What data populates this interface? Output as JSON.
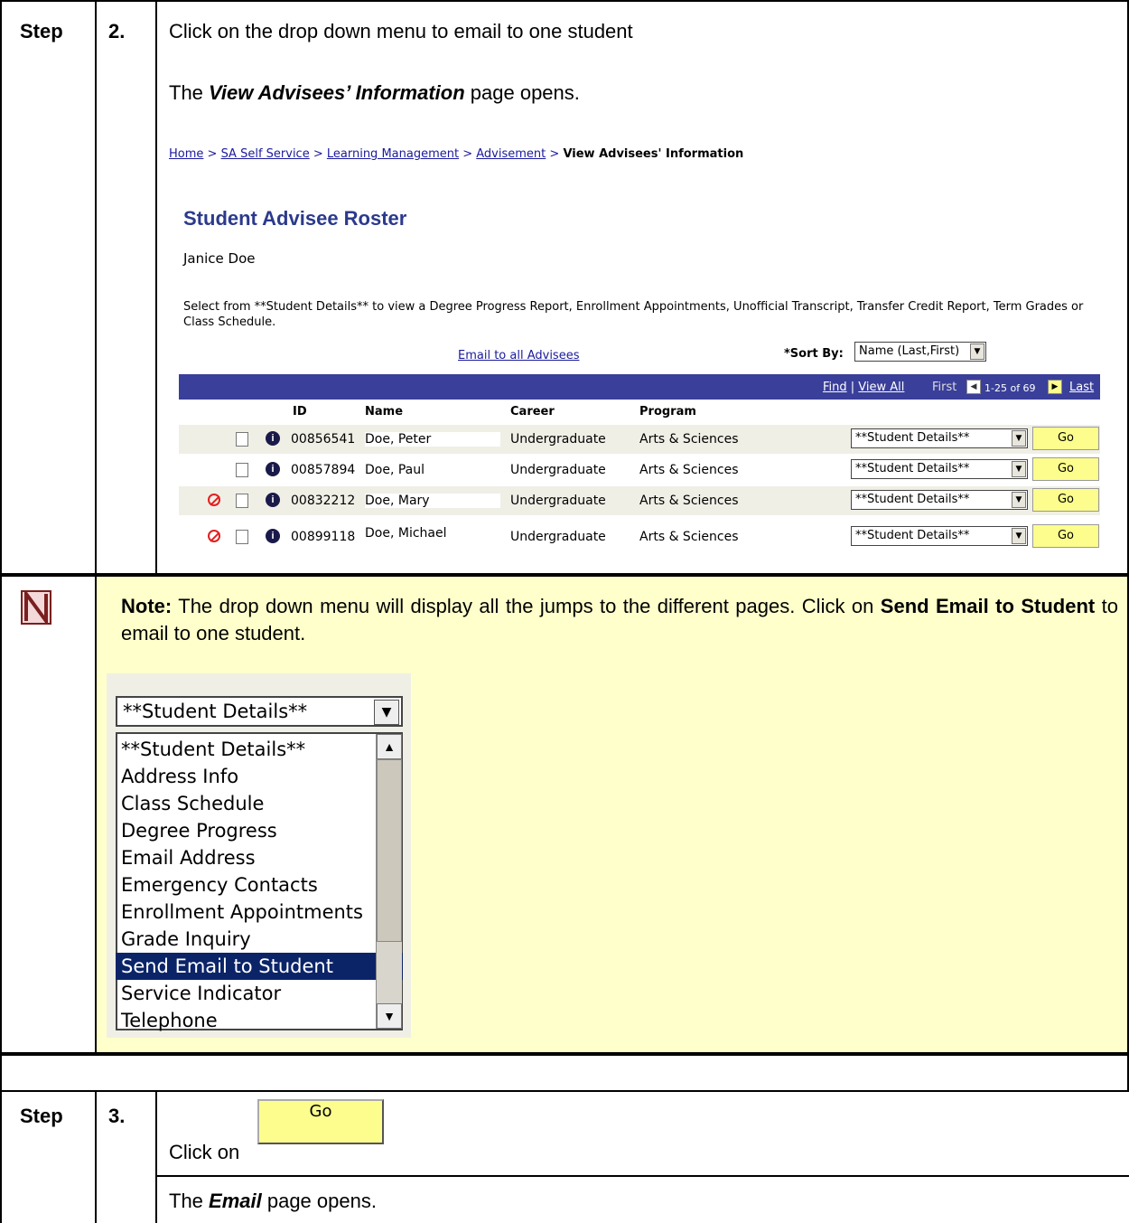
{
  "step2": {
    "step_label": "Step",
    "num": "2.",
    "instruction": "Click on the drop down menu to email to one student",
    "opens_prefix": "The ",
    "opens_page": "View Advisees’ Information",
    "opens_suffix": " page opens."
  },
  "breadcrumb": {
    "items": [
      "Home",
      "SA Self Service",
      "Learning Management",
      "Advisement"
    ],
    "sep": " > ",
    "current": "View Advisees' Information"
  },
  "roster": {
    "title": "Student Advisee Roster",
    "advisor": "Janice Doe",
    "hint": "Select from **Student Details** to view a Degree Progress Report, Enrollment Appointments, Unofficial Transcript, Transfer Credit Report, Term Grades or Class Schedule.",
    "email_all": "Email to all Advisees",
    "sort_label": "*Sort By:",
    "sort_value": "Name (Last,First)",
    "nav": {
      "find": "Find",
      "view_all": "View All",
      "sep": " | ",
      "first": "First",
      "range": "1-25 of 69",
      "last": "Last"
    },
    "headers": {
      "id": "ID",
      "name": "Name",
      "career": "Career",
      "program": "Program"
    },
    "rows": [
      {
        "id": "00856541",
        "name": "Doe, Peter",
        "career": "Undergraduate",
        "program": "Arts & Sciences",
        "detail": "**Student Details**",
        "go": "Go"
      },
      {
        "id": "00857894",
        "name": "Doe, Paul",
        "career": "Undergraduate",
        "program": "Arts & Sciences",
        "detail": "**Student Details**",
        "go": "Go"
      },
      {
        "id": "00832212",
        "name": "Doe, Mary",
        "career": "Undergraduate",
        "program": "Arts & Sciences",
        "detail": "**Student Details**",
        "go": "Go"
      },
      {
        "id": "00899118",
        "name": "Doe, Michael",
        "career": "Undergraduate",
        "program": "Arts & Sciences",
        "detail": "**Student Details**",
        "go": "Go"
      }
    ]
  },
  "note": {
    "label": "Note:",
    "text1": " The drop down menu will display all the jumps to the different pages.  Click on ",
    "bold": "Send Email to Student",
    "text2": " to email to one student.",
    "dropdown_value": "**Student Details**",
    "options": [
      "**Student Details**",
      "Address Info",
      "Class Schedule",
      "Degree Progress",
      "Email Address",
      "Emergency Contacts",
      "Enrollment Appointments",
      "Grade Inquiry",
      "Send Email to Student",
      "Service Indicator",
      "Telephone"
    ],
    "selected": "Send Email to Student"
  },
  "step3": {
    "step_label": "Step",
    "num": "3.",
    "click_on": "Click on",
    "go_label": "Go",
    "opens_prefix": "The ",
    "opens_page": "Email",
    "opens_suffix": " page opens."
  }
}
